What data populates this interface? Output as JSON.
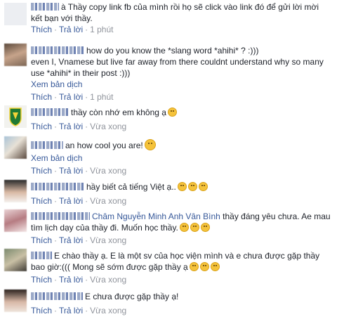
{
  "labels": {
    "like": "Thích",
    "reply": "Trả lời",
    "translate": "Xem bản dịch",
    "sep": "·"
  },
  "comments": [
    {
      "name": "",
      "text_1": "à Thầy copy link fb của mình rồi họ sẽ click vào link đó để gửi lời mời",
      "text_2": "kết bạn với thầy.",
      "time": "1 phút"
    },
    {
      "name": "",
      "text_1": "how do you know the *slang word *ahihi* ? :)))",
      "text_2": "even I, Vnamese but live far away from there couldnt understand why so many",
      "text_3": "use *ahihi* in their post :)))",
      "time": "1 phút"
    },
    {
      "name": "",
      "text_1": "thầy còn nhớ em không ạ",
      "emoji": "slight-smile-emoji",
      "time": "Vừa xong"
    },
    {
      "name": "",
      "text_1": "an how cool you are!",
      "emoji": "smile-emoji",
      "time": "Vừa xong"
    },
    {
      "name": "",
      "text_1": "hầy biết cả tiếng Việt ạ..",
      "emoji": "sad-face-emoji",
      "time": "Vừa xong"
    },
    {
      "name": "",
      "tag_1": "Châm",
      "tag_2": "Nguyễn Minh Anh Vân Bình",
      "text_1": "thầy đáng yêu chưa. Ae mau",
      "text_2": "tìm lịch dạy của thầy đi. Muốn học thầy.",
      "emoji": "laughing-tears-emoji",
      "time": "Vừa xong"
    },
    {
      "name": "",
      "text_1": "E chào thầy ạ. E là một sv của học viện mình và e chưa được gặp thầy",
      "text_2": "bao giờ:((( Mong sẽ sớm được gặp thầy ạ",
      "emoji": "grinning-emoji",
      "time": "Vừa xong"
    },
    {
      "name": "",
      "text_1": "E chưa được gặp thầy ạ!",
      "time": "Vừa xong"
    }
  ],
  "colors": {
    "link": "#365899",
    "meta": "#90949c",
    "text": "#1d2129"
  }
}
